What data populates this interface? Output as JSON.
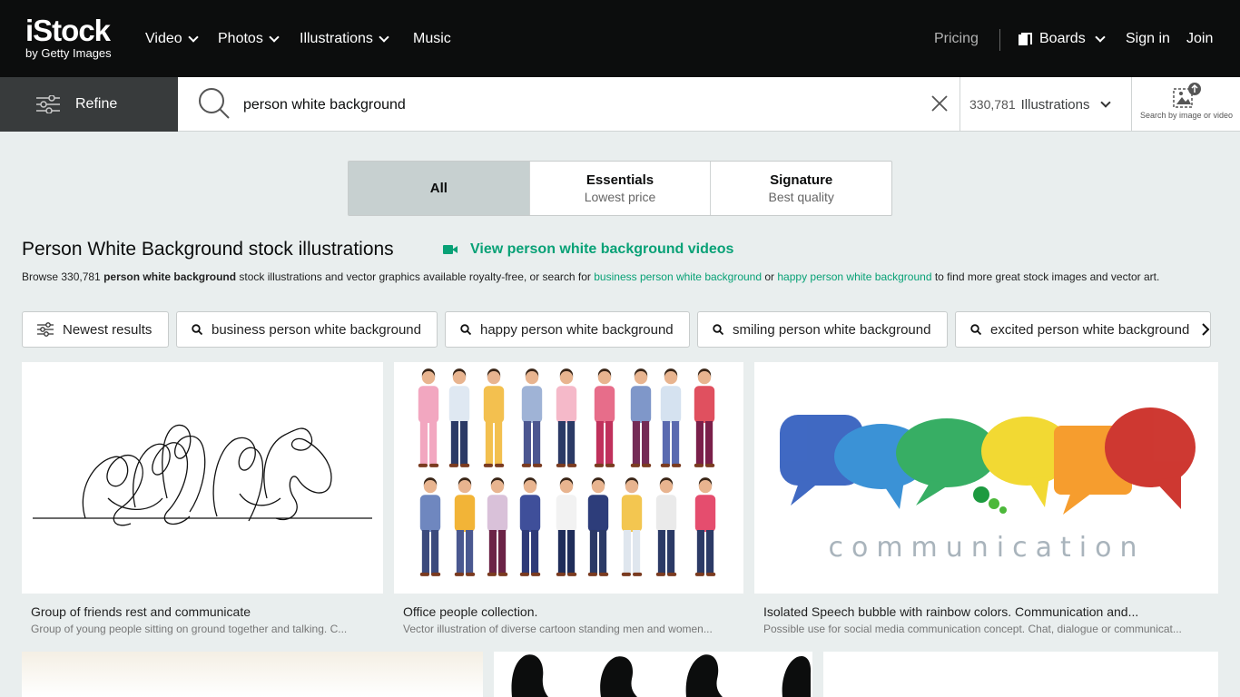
{
  "header": {
    "brand": "iStock",
    "brand_sub": "by Getty Images",
    "nav": [
      "Video",
      "Photos",
      "Illustrations",
      "Music"
    ],
    "pricing": "Pricing",
    "boards": "Boards",
    "sign_in": "Sign in",
    "join": "Join"
  },
  "search": {
    "refine": "Refine",
    "query": "person white background",
    "count": "330,781",
    "type": "Illustrations",
    "image_search_label": "Search by image or video"
  },
  "tabs": [
    {
      "title": "All",
      "subtitle": ""
    },
    {
      "title": "Essentials",
      "subtitle": "Lowest price"
    },
    {
      "title": "Signature",
      "subtitle": "Best quality"
    }
  ],
  "results": {
    "title": "Person White Background stock illustrations",
    "video_link": "View person white background videos",
    "desc_prefix": "Browse 330,781 ",
    "desc_bold": "person white background",
    "desc_mid": " stock illustrations and vector graphics available royalty-free, or search for ",
    "desc_link1": "business person white background",
    "desc_or": " or ",
    "desc_link2": "happy person white background",
    "desc_suffix": " to find more great stock images and vector art."
  },
  "chips": [
    "Newest results",
    "business person white background",
    "happy person white background",
    "smiling person white background",
    "excited person white background"
  ],
  "cards": [
    {
      "caption": "Group of friends rest and communicate",
      "subcaption": "Group of young people sitting on ground together and talking. C..."
    },
    {
      "caption": "Office people collection.",
      "subcaption": "Vector illustration of diverse cartoon standing men and women..."
    },
    {
      "caption": "Isolated Speech bubble with rainbow colors. Communication and...",
      "subcaption": "Possible use for social media communication concept. Chat, dialogue or communicat...",
      "art_text": "communication"
    }
  ],
  "colors": {
    "accent": "#08a176",
    "nav_bg": "#0c0d0d",
    "refine_bg": "#383b3c",
    "page_bg": "#e9eeee"
  }
}
